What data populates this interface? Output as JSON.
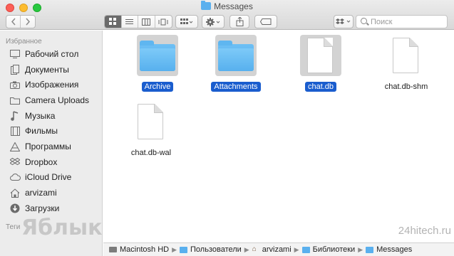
{
  "window": {
    "title": "Messages"
  },
  "toolbar": {
    "back_icon": "chevron-left-icon",
    "forward_icon": "chevron-right-icon",
    "view_modes": [
      "icon-view-icon",
      "list-view-icon",
      "column-view-icon",
      "cover-flow-icon"
    ],
    "active_view": "icon-view-icon",
    "search_placeholder": "Поиск"
  },
  "sidebar": {
    "favorites_header": "Избранное",
    "items": [
      {
        "label": "Рабочий стол",
        "icon": "desktop-icon"
      },
      {
        "label": "Документы",
        "icon": "documents-icon"
      },
      {
        "label": "Изображения",
        "icon": "camera-icon"
      },
      {
        "label": "Camera Uploads",
        "icon": "folder-icon"
      },
      {
        "label": "Музыка",
        "icon": "music-icon"
      },
      {
        "label": "Фильмы",
        "icon": "film-icon"
      },
      {
        "label": "Программы",
        "icon": "apps-icon"
      },
      {
        "label": "Dropbox",
        "icon": "dropbox-icon"
      },
      {
        "label": "iCloud Drive",
        "icon": "cloud-icon"
      },
      {
        "label": "arvizami",
        "icon": "home-icon"
      },
      {
        "label": "Загрузки",
        "icon": "downloads-icon"
      }
    ],
    "tags_header": "Теги"
  },
  "files": [
    {
      "name": "Archive",
      "kind": "folder",
      "selected": true
    },
    {
      "name": "Attachments",
      "kind": "folder",
      "selected": true
    },
    {
      "name": "chat.db",
      "kind": "document",
      "selected": true
    },
    {
      "name": "chat.db-shm",
      "kind": "document",
      "selected": false
    },
    {
      "name": "chat.db-wal",
      "kind": "document",
      "selected": false
    }
  ],
  "pathbar": [
    {
      "label": "Macintosh HD",
      "icon": "hard-drive-icon"
    },
    {
      "label": "Пользователи",
      "icon": "folder-icon"
    },
    {
      "label": "arvizami",
      "icon": "home-icon"
    },
    {
      "label": "Библиотеки",
      "icon": "folder-icon"
    },
    {
      "label": "Messages",
      "icon": "folder-icon"
    }
  ],
  "watermarks": {
    "left": "Яблык",
    "right": "24hitech.ru"
  }
}
